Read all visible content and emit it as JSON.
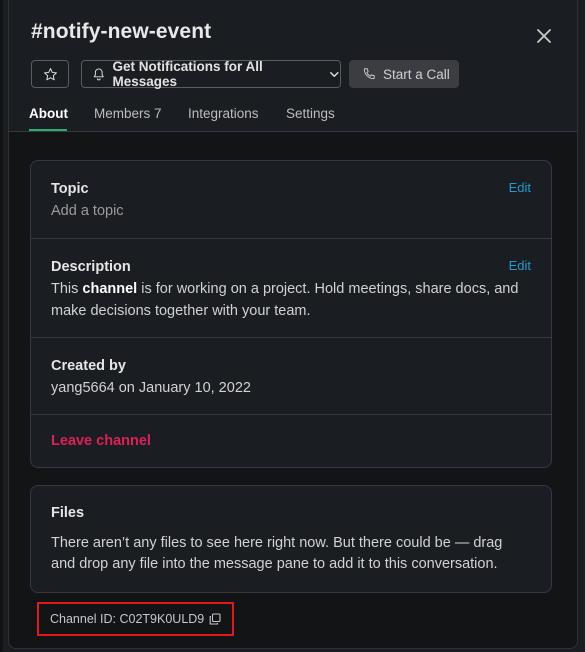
{
  "header": {
    "title": "#notify-new-event",
    "notifications_button": "Get Notifications for All Messages",
    "call_button": "Start a Call"
  },
  "tabs": [
    {
      "label": "About",
      "active": true
    },
    {
      "label": "Members 7",
      "active": false
    },
    {
      "label": "Integrations",
      "active": false
    },
    {
      "label": "Settings",
      "active": false
    }
  ],
  "about": {
    "topic": {
      "label": "Topic",
      "placeholder": "Add a topic",
      "edit": "Edit"
    },
    "description": {
      "label": "Description",
      "edit": "Edit",
      "text_before": "This ",
      "text_bold": "channel",
      "text_after": " is for working on a project. Hold meetings, share docs, and make decisions together with your team."
    },
    "created": {
      "label": "Created by",
      "value": "yang5664 on January 10, 2022"
    },
    "leave": "Leave channel"
  },
  "files": {
    "label": "Files",
    "text": "There aren’t any files to see here right now. But there could be — drag and drop any file into the message pane to add it to this conversation."
  },
  "channel_id": "Channel ID: C02T9K0ULD9",
  "icons": {
    "star": "star-icon",
    "bell": "bell-icon",
    "chevron": "chevron-down-icon",
    "phone": "phone-icon",
    "close": "close-icon",
    "copy": "copy-icon"
  },
  "colors": {
    "accent_tab": "#2bac76",
    "link": "#1d9bd1",
    "danger": "#e01e5a",
    "highlight_box": "#e0191e"
  }
}
